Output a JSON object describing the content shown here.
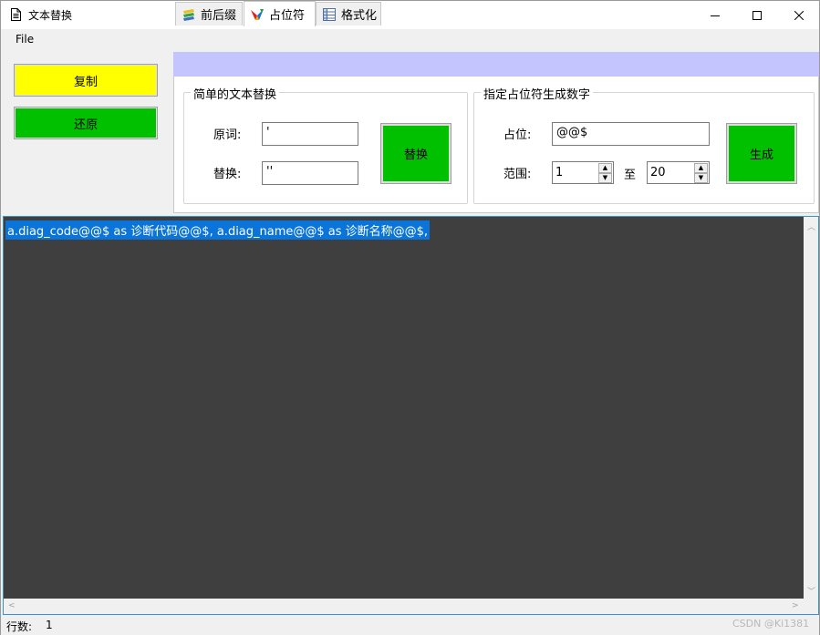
{
  "window": {
    "title": "文本替换"
  },
  "menu": {
    "file": "File"
  },
  "left_buttons": {
    "copy": "复制",
    "restore": "还原"
  },
  "tabs": [
    {
      "label": "前后缀",
      "icon": "stack-icon"
    },
    {
      "label": "占位符",
      "icon": "colorful-v-icon"
    },
    {
      "label": "格式化",
      "icon": "table-icon"
    }
  ],
  "simple_replace": {
    "title": "简单的文本替换",
    "original_label": "原词:",
    "original_value": "'",
    "replace_label": "替换:",
    "replace_value": "''",
    "button": "替换"
  },
  "placeholder_gen": {
    "title": "指定占位符生成数字",
    "placeholder_label": "占位:",
    "placeholder_value": "@@$",
    "range_label": "范围:",
    "range_from": "1",
    "range_to_label": "至",
    "range_to": "20",
    "button": "生成"
  },
  "editor": {
    "text": "a.diag_code@@$ as 诊断代码@@$, a.diag_name@@$ as 诊断名称@@$,"
  },
  "status": {
    "line_label": "行数:",
    "line_value": "1"
  },
  "watermark": "CSDN @Ki1381",
  "colors": {
    "copy_button": "#ffff00",
    "green_button": "#00c000",
    "tabstrip": "#c4c4ff",
    "editor_bg": "#3f3f3f",
    "selection": "#0a74d8"
  }
}
